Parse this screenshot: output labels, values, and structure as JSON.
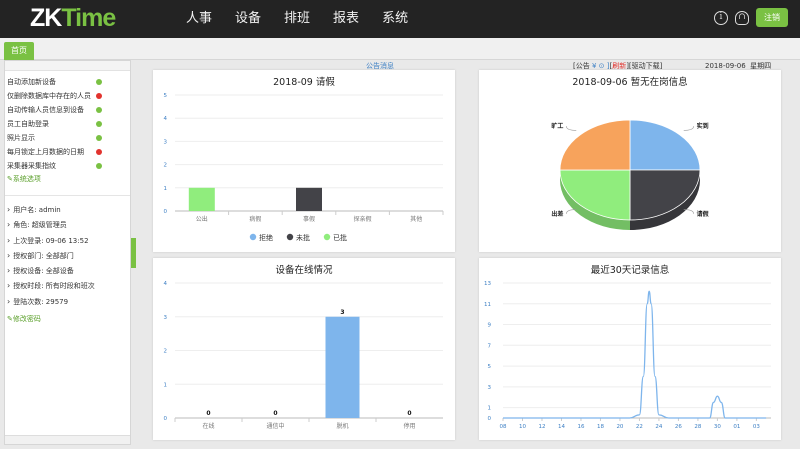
{
  "app": {
    "logo_main": "ZK",
    "logo_accent": "Time"
  },
  "nav": [
    "人事",
    "设备",
    "排班",
    "报表",
    "系统"
  ],
  "header": {
    "logout_label": "注销"
  },
  "tabs": {
    "home_label": "首页"
  },
  "sidebar": {
    "ops": [
      {
        "label": "自动添加新设备",
        "status": "green"
      },
      {
        "label": "仅删除数据库中存在的人员",
        "status": "red"
      },
      {
        "label": "自动传输人员信息到设备",
        "status": "green"
      },
      {
        "label": "员工自助登录",
        "status": "green"
      },
      {
        "label": "照片显示",
        "status": "green"
      },
      {
        "label": "每月锁定上月数据的日期",
        "status": "red"
      },
      {
        "label": "采集器采集指纹",
        "status": "green"
      }
    ],
    "options_link": "系统选项",
    "info": [
      "用户名: admin",
      "角色: 超级管理员",
      "上次登录: 09-06 13:52",
      "授权部门: 全部部门",
      "授权设备: 全部设备",
      "授权时段: 所有时段和班次",
      "登陆次数: 29579"
    ],
    "password_link": "修改密码"
  },
  "notice": {
    "title": "公告消息",
    "controls_prefix": "[公告",
    "controls_refresh": "刷新",
    "controls_download": "驱动下载",
    "date": "2018-09-06",
    "weekday": "星期四"
  },
  "colors": {
    "accent": "#7ac143",
    "blue": "#7eb5ec",
    "dark": "#434348",
    "green": "#90ed7d",
    "orange": "#f7a35c"
  },
  "chart_data": [
    {
      "id": "leave",
      "type": "bar",
      "title": "2018-09 请假",
      "categories": [
        "公出",
        "病假",
        "事假",
        "探亲假",
        "其他"
      ],
      "ylim": [
        0,
        5
      ],
      "yticks": [
        0,
        1,
        2,
        3,
        4,
        5
      ],
      "series": [
        {
          "name": "拒绝",
          "color": "#7eb5ec",
          "values": [
            0,
            0,
            0,
            0,
            0
          ]
        },
        {
          "name": "未批",
          "color": "#434348",
          "values": [
            0,
            0,
            1,
            0,
            0
          ]
        },
        {
          "name": "已批",
          "color": "#90ed7d",
          "values": [
            1,
            0,
            0,
            0,
            0
          ]
        }
      ],
      "legend": "bottom"
    },
    {
      "id": "onduty",
      "type": "pie",
      "title": "2018-09-06 暂无在岗信息",
      "slices": [
        {
          "name": "实到",
          "value": 25,
          "color": "#7eb5ec"
        },
        {
          "name": "请假",
          "value": 25,
          "color": "#434348"
        },
        {
          "name": "出差",
          "value": 25,
          "color": "#90ed7d"
        },
        {
          "name": "旷工",
          "value": 25,
          "color": "#f7a35c"
        }
      ]
    },
    {
      "id": "devices",
      "type": "bar",
      "title": "设备在线情况",
      "categories": [
        "在线",
        "通信中",
        "脱机",
        "停用"
      ],
      "values": [
        0,
        0,
        3,
        0
      ],
      "color": "#7eb5ec",
      "ylim": [
        0,
        4
      ],
      "yticks": [
        0,
        1,
        2,
        3,
        4
      ]
    },
    {
      "id": "records",
      "type": "line",
      "title": "最近30天记录信息",
      "x": [
        "08",
        "10",
        "12",
        "14",
        "16",
        "18",
        "20",
        "22",
        "24",
        "26",
        "28",
        "30",
        "01",
        "03"
      ],
      "ylim": [
        0,
        13
      ],
      "yticks": [
        0,
        1,
        3,
        5,
        7,
        9,
        11,
        13
      ],
      "color": "#7eb5ec",
      "points": [
        [
          8,
          0
        ],
        [
          10,
          0
        ],
        [
          12,
          0
        ],
        [
          14,
          0
        ],
        [
          16,
          0
        ],
        [
          18,
          0
        ],
        [
          20,
          0
        ],
        [
          21,
          0
        ],
        [
          22,
          0.3
        ],
        [
          22.4,
          4
        ],
        [
          22.8,
          11
        ],
        [
          23,
          12.2
        ],
        [
          23.2,
          11
        ],
        [
          23.6,
          4
        ],
        [
          24,
          0.3
        ],
        [
          25,
          0
        ],
        [
          28,
          0
        ],
        [
          29.2,
          0
        ],
        [
          29.6,
          1.5
        ],
        [
          30,
          2.1
        ],
        [
          30.4,
          1.5
        ],
        [
          30.8,
          0
        ],
        [
          32,
          0
        ],
        [
          35,
          0
        ]
      ],
      "x_numeric": [
        8,
        10,
        12,
        14,
        16,
        18,
        20,
        22,
        24,
        26,
        28,
        30,
        32,
        34
      ]
    }
  ]
}
